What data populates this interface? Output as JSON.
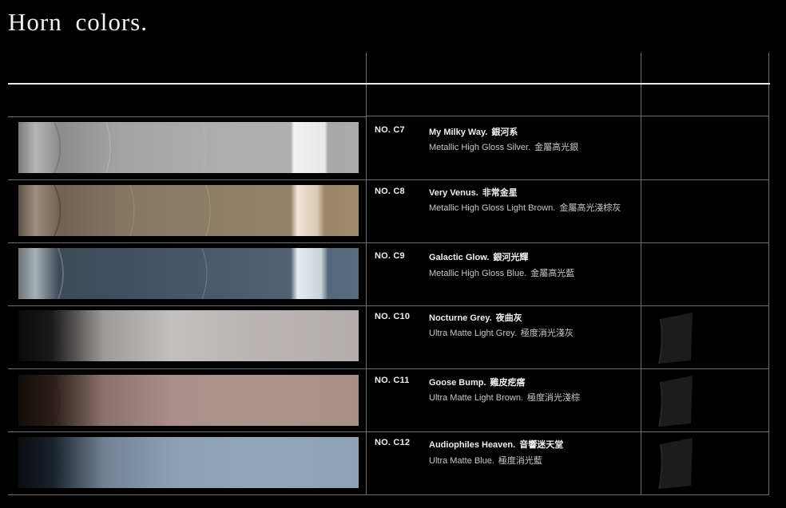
{
  "title": "Horn colors.",
  "colors": {
    "background": "#000000",
    "text": "#f0f0f0",
    "grid_line": "#6e6e6e",
    "rule": "#e8e8e8"
  },
  "rows": [
    {
      "code": "NO. C7",
      "name_en": "My Milky Way.",
      "name_zh": "銀河系",
      "finish_en": "Metallic High Gloss Silver.",
      "finish_zh": "金屬高光銀",
      "swatch_color": "#a8a8a8"
    },
    {
      "code": "NO. C8",
      "name_en": "Very Venus.",
      "name_zh": "非常金星",
      "finish_en": "Metallic High Gloss Light Brown.",
      "finish_zh": "金屬高光淺棕灰",
      "swatch_color": "#8f7f6a"
    },
    {
      "code": "NO. C9",
      "name_en": "Galactic Glow.",
      "name_zh": "銀河光輝",
      "finish_en": "Metallic High Gloss Blue.",
      "finish_zh": "金屬高光藍",
      "swatch_color": "#4e6070"
    },
    {
      "code": "NO. C10",
      "name_en": "Nocturne Grey.",
      "name_zh": "夜曲灰",
      "finish_en": "Ultra Matte Light Grey.",
      "finish_zh": "極度消光淺灰",
      "swatch_color": "#b8b3b0"
    },
    {
      "code": "NO. C11",
      "name_en": "Goose Bump.",
      "name_zh": "雞皮疙瘩",
      "finish_en": "Ultra Matte Light Brown.",
      "finish_zh": "極度消光淺棕",
      "swatch_color": "#a8918a"
    },
    {
      "code": "NO. C12",
      "name_en": "Audiophiles Heaven.",
      "name_zh": "音響迷天堂",
      "finish_en": "Ultra Matte Blue.",
      "finish_zh": "極度消光藍",
      "swatch_color": "#8da0b4"
    }
  ]
}
